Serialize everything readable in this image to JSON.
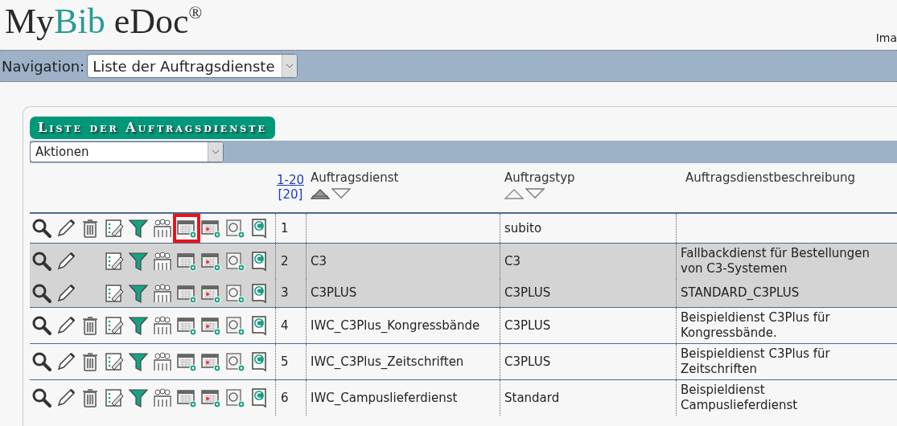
{
  "logo": {
    "parts": [
      "My",
      "Bib",
      "eDoc"
    ],
    "mark": "®"
  },
  "user_text": "Ima",
  "navigation": {
    "label": "Navigation:",
    "value": "Liste der Auftragsdienste"
  },
  "panel": {
    "title": "Liste der Auftragsdienste",
    "actions": {
      "value": "Aktionen"
    }
  },
  "pager": {
    "range": "1-20",
    "size": "[20]"
  },
  "columns": [
    {
      "label": "Auftragsdienst",
      "sortable": true,
      "sorted_ascending": true
    },
    {
      "label": "Auftragstyp",
      "sortable": true,
      "sorted_ascending": false
    },
    {
      "label": "Auftragsdienstbeschreibung",
      "sortable": false
    }
  ],
  "rows": [
    {
      "number": "1",
      "service": "",
      "type": "subito",
      "description": "",
      "selected": false,
      "deletable": true,
      "outlined_action": true
    },
    {
      "number": "2",
      "service": "C3",
      "type": "C3",
      "description": "Fallbackdienst für Bestellungen von C3-Systemen",
      "selected": true,
      "deletable": false,
      "outlined_action": false
    },
    {
      "number": "3",
      "service": "C3PLUS",
      "type": "C3PLUS",
      "description": "STANDARD_C3PLUS",
      "selected": true,
      "deletable": false,
      "outlined_action": false
    },
    {
      "number": "4",
      "service": "IWC_C3Plus_Kongressbände",
      "type": "C3PLUS",
      "description": "Beispieldienst C3Plus für Kongressbände.",
      "selected": false,
      "deletable": true,
      "outlined_action": false
    },
    {
      "number": "5",
      "service": "IWC_C3Plus_Zeitschriften",
      "type": "C3PLUS",
      "description": "Beispieldienst C3Plus für Zeitschriften",
      "selected": false,
      "deletable": true,
      "outlined_action": false
    },
    {
      "number": "6",
      "service": "IWC_Campuslieferdienst",
      "type": "Standard",
      "description": "Beispieldienst Campuslieferdienst",
      "selected": false,
      "deletable": true,
      "outlined_action": false
    }
  ]
}
